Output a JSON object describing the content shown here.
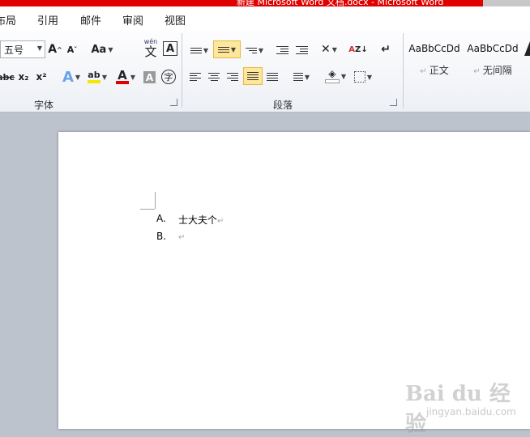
{
  "titlebar": {
    "text": "新建 Microsoft Word 文档.docx - Microsoft Word"
  },
  "menu": {
    "tabs": [
      "布局",
      "引用",
      "邮件",
      "审阅",
      "视图"
    ]
  },
  "font_group": {
    "font_size": "五号",
    "grow_label": "A",
    "shrink_label": "A",
    "change_case_label": "Aa",
    "phonetic_label": "wén",
    "phonetic_char": "文",
    "border_char": "A",
    "strike_label": "abc",
    "subscript_label": "x₂",
    "superscript_label": "x²",
    "text_effect_label": "A",
    "highlight_label": "ab",
    "font_color_label": "A",
    "char_shade_label": "A",
    "enclose_label": "字",
    "group_label": "字体"
  },
  "paragraph_group": {
    "group_label": "段落"
  },
  "styles": [
    {
      "sample": "AaBbCcDd",
      "name": "正文"
    },
    {
      "sample": "AaBbCcDd",
      "name": "无间隔"
    }
  ],
  "document": {
    "items": [
      {
        "marker": "A.",
        "text": "士大夫个"
      },
      {
        "marker": "B.",
        "text": ""
      }
    ],
    "paragraph_mark": "↵"
  },
  "watermark": {
    "brand": "Bai du 经验",
    "url": "jingyan.baidu.com"
  },
  "colors": {
    "titlebar": "#e00000",
    "active_button": "#fde79a",
    "highlight": "#f2e800",
    "font_color": "#e00000"
  }
}
